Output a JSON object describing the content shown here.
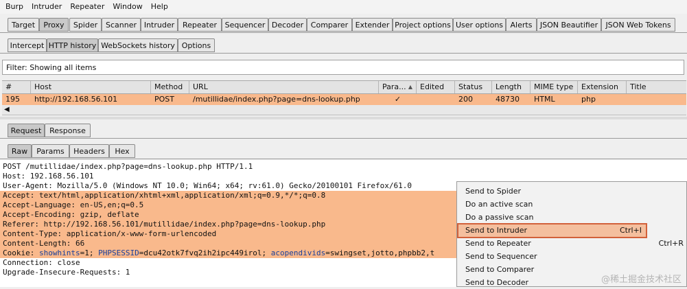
{
  "menubar": [
    "Burp",
    "Intruder",
    "Repeater",
    "Window",
    "Help"
  ],
  "top_tabs": [
    "Target",
    "Proxy",
    "Spider",
    "Scanner",
    "Intruder",
    "Repeater",
    "Sequencer",
    "Decoder",
    "Comparer",
    "Extender",
    "Project options",
    "User options",
    "Alerts",
    "JSON Beautifier",
    "JSON Web Tokens"
  ],
  "top_tab_active": "Proxy",
  "proxy_tabs": [
    "Intercept",
    "HTTP history",
    "WebSockets history",
    "Options"
  ],
  "proxy_tab_active": "HTTP history",
  "filter_text": "Filter: Showing all items",
  "table": {
    "columns": [
      "#",
      "Host",
      "Method",
      "URL",
      "Para...",
      "Edited",
      "Status",
      "Length",
      "MIME type",
      "Extension",
      "Title"
    ],
    "sort_indicator": "▲",
    "row": {
      "num": "195",
      "host": "http://192.168.56.101",
      "method": "POST",
      "url": "/mutillidae/index.php?page=dns-lookup.php",
      "params": "✓",
      "edited": "",
      "status": "200",
      "length": "48730",
      "mime": "HTML",
      "extension": "php",
      "title": ""
    }
  },
  "req_tabs": [
    "Request",
    "Response"
  ],
  "req_tab_active": "Request",
  "view_tabs": [
    "Raw",
    "Params",
    "Headers",
    "Hex"
  ],
  "view_tab_active": "Raw",
  "request_lines": [
    "POST /mutillidae/index.php?page=dns-lookup.php HTTP/1.1",
    "Host: 192.168.56.101",
    "User-Agent: Mozilla/5.0 (Windows NT 10.0; Win64; x64; rv:61.0) Gecko/20100101 Firefox/61.0",
    "Accept: text/html,application/xhtml+xml,application/xml;q=0.9,*/*;q=0.8",
    "Accept-Language: en-US,en;q=0.5",
    "Accept-Encoding: gzip, deflate",
    "Referer: http://192.168.56.101/mutillidae/index.php?page=dns-lookup.php",
    "Content-Type: application/x-www-form-urlencoded",
    "Content-Length: 66",
    "Cookie: showhints=1; PHPSESSID=dcu42otk7fvq2ih2ipc449irol; acopendivids=swingset,jotto,phpbb2,t",
    "Connection: close",
    "Upgrade-Insecure-Requests: 1"
  ],
  "cookie_parts": {
    "prefix": "Cookie: ",
    "showhints": "showhints",
    "eq1": "=1; ",
    "phpsessid": "PHPSESSID",
    "eq2": "=dcu42otk7fvq2ih2ipc449irol; ",
    "acopen": "acopendivids",
    "eq3": "=swingset,jotto,phpbb2,t"
  },
  "context_menu": [
    {
      "label": "Send to Spider",
      "shortcut": ""
    },
    {
      "label": "Do an active scan",
      "shortcut": ""
    },
    {
      "label": "Do a passive scan",
      "shortcut": ""
    },
    {
      "label": "Send to Intruder",
      "shortcut": "Ctrl+I"
    },
    {
      "label": "Send to Repeater",
      "shortcut": "Ctrl+R"
    },
    {
      "label": "Send to Sequencer",
      "shortcut": ""
    },
    {
      "label": "Send to Comparer",
      "shortcut": ""
    },
    {
      "label": "Send to Decoder",
      "shortcut": ""
    }
  ],
  "context_menu_hover": "Send to Intruder",
  "watermark": "@稀土掘金技术社区",
  "colors": {
    "highlight": "#f9b98c",
    "menu_hover_border": "#d2603a",
    "cookie_name": "#1a3f9a"
  }
}
